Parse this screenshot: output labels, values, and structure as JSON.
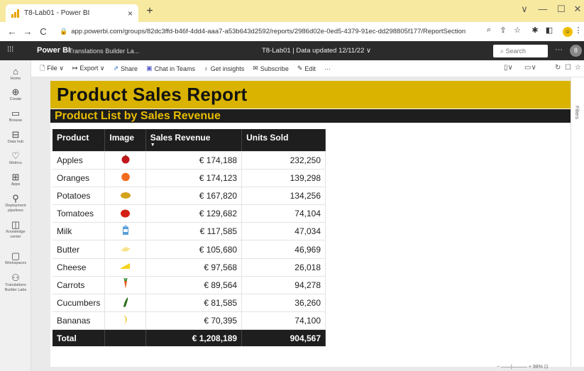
{
  "browser": {
    "tab_title": "T8-Lab01 - Power BI",
    "tab_close": "×",
    "new_tab": "+",
    "url": "app.powerbi.com/groups/82dc3ffd-b46f-4dd4-aaa7-a53b643d2592/reports/2986d02e-0ed5-4379-91ec-dd298805f177/ReportSection",
    "nav": {
      "back": "←",
      "forward": "→",
      "reload": "C"
    },
    "window": {
      "collapse": "∨",
      "minimize": "—",
      "maximize": "☐",
      "close": "✕"
    }
  },
  "pbi_header": {
    "brand": "Power BI",
    "workspace": "Translations Builder La...",
    "report_status": "T8-Lab01  |  Data updated 12/11/22  ∨",
    "search_placeholder": "Search",
    "more": "···",
    "avatar_initial": "8"
  },
  "left_nav": [
    {
      "label": "Home",
      "icon": "home-icon",
      "glyph": "⌂"
    },
    {
      "label": "Create",
      "icon": "plus-circle-icon",
      "glyph": "⊕"
    },
    {
      "label": "Browse",
      "icon": "folder-icon",
      "glyph": "▭"
    },
    {
      "label": "Data hub",
      "icon": "database-icon",
      "glyph": "⊟"
    },
    {
      "label": "Metrics",
      "icon": "trophy-icon",
      "glyph": "♡"
    },
    {
      "label": "Apps",
      "icon": "apps-icon",
      "glyph": "⊞"
    },
    {
      "label": "Deployment pipelines",
      "icon": "rocket-icon",
      "glyph": "⚲"
    },
    {
      "label": "Knowledge center",
      "icon": "book-icon",
      "glyph": "◫"
    },
    {
      "label": "Workspaces",
      "icon": "monitor-icon",
      "glyph": "▢"
    },
    {
      "label": "Translations Builder Labs",
      "icon": "people-icon",
      "glyph": "⚇"
    }
  ],
  "toolbar": {
    "file": "File ∨",
    "export": "Export ∨",
    "share": "Share",
    "teams": "Chat in Teams",
    "insights": "Get insights",
    "subscribe": "Subscribe",
    "edit": "Edit",
    "more": "···"
  },
  "report": {
    "title": "Product Sales Report",
    "subtitle": "Product List by Sales Revenue",
    "columns": [
      "Product",
      "Image",
      "Sales Revenue",
      "Units Sold"
    ],
    "rows": [
      {
        "product": "Apples",
        "image": "apple",
        "revenue": "€ 174,188",
        "units": "232,250"
      },
      {
        "product": "Oranges",
        "image": "orange",
        "revenue": "€ 174,123",
        "units": "139,298"
      },
      {
        "product": "Potatoes",
        "image": "potato",
        "revenue": "€ 167,820",
        "units": "134,256"
      },
      {
        "product": "Tomatoes",
        "image": "tomato",
        "revenue": "€ 129,682",
        "units": "74,104"
      },
      {
        "product": "Milk",
        "image": "milk",
        "revenue": "€ 117,585",
        "units": "47,034"
      },
      {
        "product": "Butter",
        "image": "butter",
        "revenue": "€ 105,680",
        "units": "46,969"
      },
      {
        "product": "Cheese",
        "image": "cheese",
        "revenue": "€ 97,568",
        "units": "26,018"
      },
      {
        "product": "Carrots",
        "image": "carrot",
        "revenue": "€ 89,564",
        "units": "94,278"
      },
      {
        "product": "Cucumbers",
        "image": "cucumber",
        "revenue": "€ 81,585",
        "units": "36,260"
      },
      {
        "product": "Bananas",
        "image": "banana",
        "revenue": "€ 70,395",
        "units": "74,100"
      }
    ],
    "total": {
      "label": "Total",
      "revenue": "€ 1,208,189",
      "units": "904,567"
    }
  },
  "right_pane_label": "Filters",
  "zoom": "98%",
  "colors": {
    "accent": "#d9b300",
    "header_dark": "#1e1e1e",
    "subtitle_gold": "#e8bd00",
    "tab_strip": "#f7e9a0"
  }
}
